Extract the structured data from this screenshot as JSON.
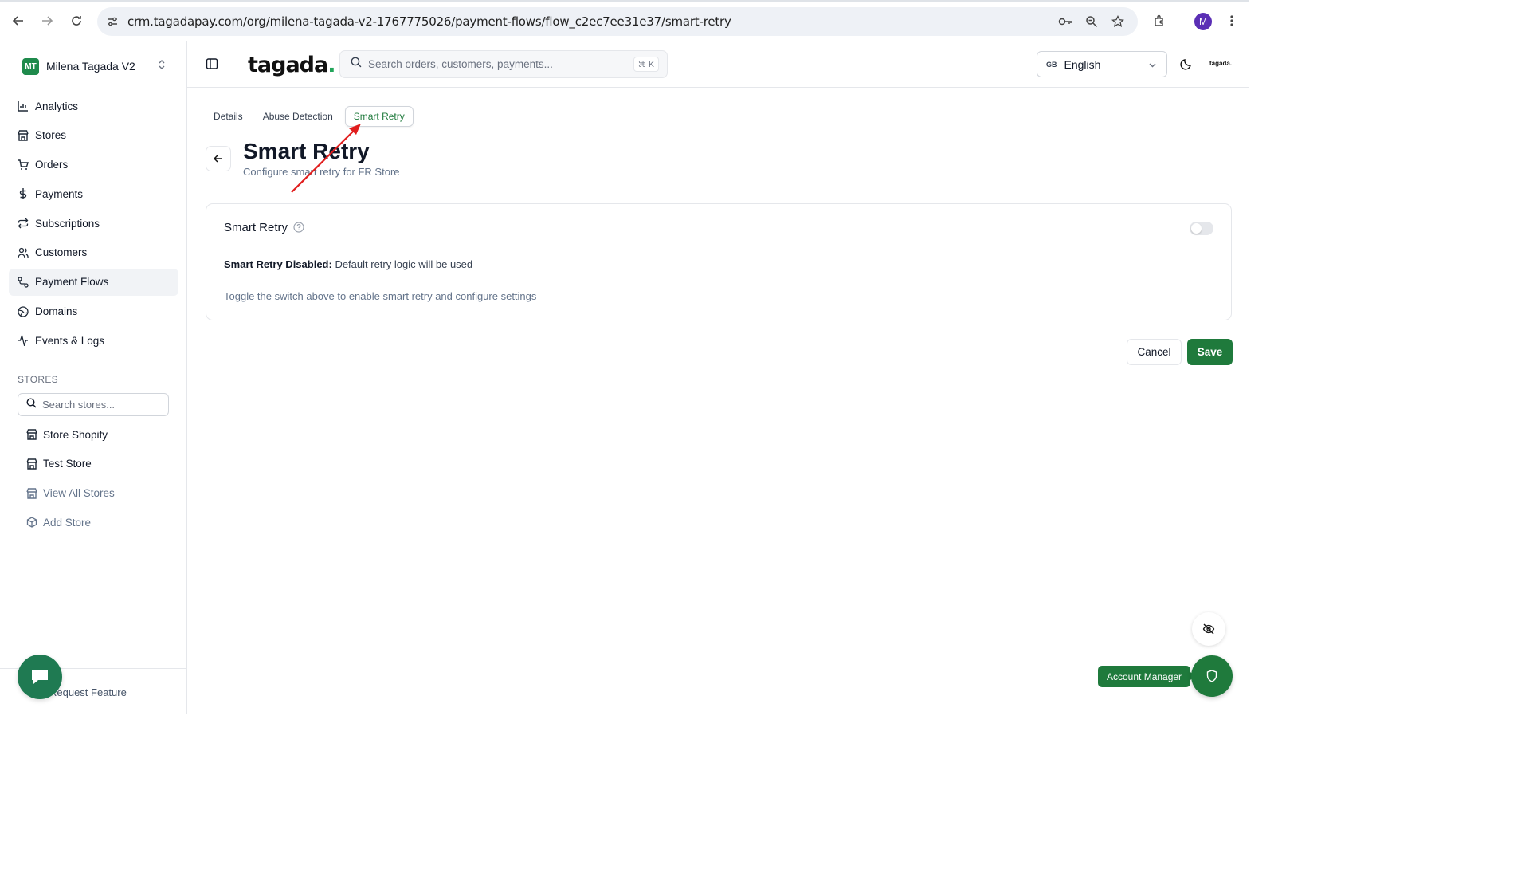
{
  "browser": {
    "url": "crm.tagadapay.com/org/milena-tagada-v2-1767775026/payment-flows/flow_c2ec7ee31e37/smart-retry",
    "profile_initial": "M"
  },
  "sidebar": {
    "org_initials": "MT",
    "org_name": "Milena Tagada V2",
    "items": [
      {
        "label": "Analytics",
        "icon": "chart-icon"
      },
      {
        "label": "Stores",
        "icon": "store-icon"
      },
      {
        "label": "Orders",
        "icon": "cart-icon"
      },
      {
        "label": "Payments",
        "icon": "dollar-icon"
      },
      {
        "label": "Subscriptions",
        "icon": "repeat-icon"
      },
      {
        "label": "Customers",
        "icon": "users-icon"
      },
      {
        "label": "Payment Flows",
        "icon": "flow-icon"
      },
      {
        "label": "Domains",
        "icon": "globe-icon"
      },
      {
        "label": "Events & Logs",
        "icon": "activity-icon"
      }
    ],
    "stores_label": "STORES",
    "store_search_placeholder": "Search stores...",
    "stores": [
      {
        "label": "Store Shopify"
      },
      {
        "label": "Test Store"
      },
      {
        "label": "View All Stores"
      },
      {
        "label": "Add Store"
      }
    ],
    "footer_label": "Request Feature"
  },
  "header": {
    "logo_text": "tagada",
    "logo_dot": ".",
    "search_placeholder": "Search orders, customers, payments...",
    "search_shortcut": "⌘ K",
    "language_flag": "GB",
    "language": "English",
    "mini_logo": "tagada."
  },
  "main": {
    "tabs": [
      {
        "label": "Details"
      },
      {
        "label": "Abuse Detection"
      },
      {
        "label": "Smart Retry",
        "active": true
      }
    ],
    "title": "Smart Retry",
    "subtitle": "Configure smart retry for FR Store",
    "card": {
      "title": "Smart Retry",
      "toggle_on": false,
      "status_bold": "Smart Retry Disabled:",
      "status_text": " Default retry logic will be used",
      "hint": "Toggle the switch above to enable smart retry and configure settings"
    },
    "cancel_label": "Cancel",
    "save_label": "Save"
  },
  "floating": {
    "account_manager_label": "Account Manager"
  },
  "colors": {
    "brand_green": "#1f7a3c",
    "annotation_arrow": "#e11d1d"
  }
}
